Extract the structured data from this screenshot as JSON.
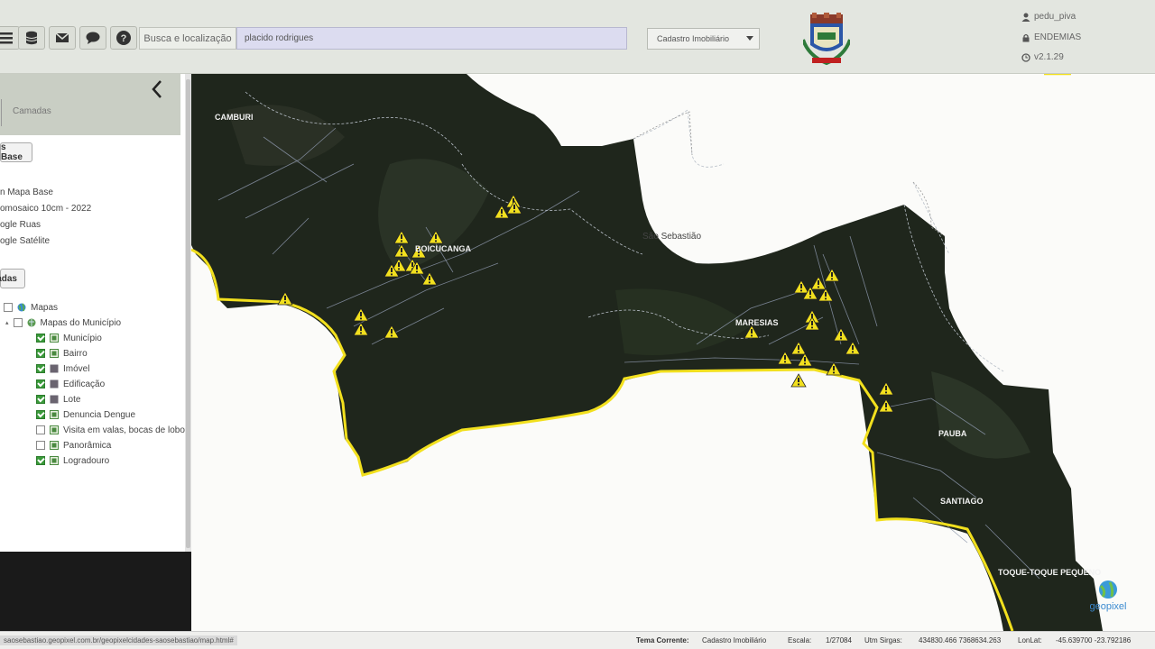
{
  "toolbar": {
    "search_label": "Busca e localização",
    "search_value": "placido rodrigues",
    "tema_selected": "Cadastro Imobiliário",
    "user": "pedu_piva",
    "group": "ENDEMIAS",
    "version": "v2.1.29"
  },
  "sidebar": {
    "title": "Camadas",
    "base_button": "s Base",
    "base_items": [
      "n Mapa Base",
      "omosaico 10cm - 2022",
      "ogle Ruas",
      "ogle Satélite"
    ],
    "layers_button": "adas",
    "layers": [
      {
        "label": "Mapas",
        "checked": false,
        "icon": "globe-icon"
      },
      {
        "label": "Mapas do Município",
        "checked": false,
        "icon": "folder-icon"
      },
      {
        "label": "Município",
        "checked": true,
        "icon": "layer-icon"
      },
      {
        "label": "Bairro",
        "checked": true,
        "icon": "layer-icon"
      },
      {
        "label": "Imóvel",
        "checked": true,
        "icon": "square-icon"
      },
      {
        "label": "Edificação",
        "checked": true,
        "icon": "square-icon"
      },
      {
        "label": "Lote",
        "checked": true,
        "icon": "square-icon"
      },
      {
        "label": "Denuncia Dengue",
        "checked": true,
        "icon": "layer-icon"
      },
      {
        "label": "Visita em valas, bocas de lobo",
        "checked": false,
        "icon": "layer-icon"
      },
      {
        "label": "Panorâmica",
        "checked": false,
        "icon": "layer-icon"
      },
      {
        "label": "Logradouro",
        "checked": true,
        "icon": "layer-icon"
      }
    ]
  },
  "map": {
    "places": {
      "camburi": "CAMBURI",
      "boicucanga": "BOICUCANGA",
      "sao_sebastiao": "São Sebastião",
      "maresias": "MARESIAS",
      "pauba": "PAUBA",
      "santiago": "SANTIAGO",
      "toque": "TOQUE-TOQUE PEQUENO"
    },
    "logo_text": "geopixel"
  },
  "status": {
    "url": "saosebastiao.geopixel.com.br/geopixelcidades-saosebastiao/map.html#",
    "tema_label": "Tema Corrente:",
    "tema_value": "Cadastro Imobiliário",
    "escala_label": "Escala:",
    "escala_value": "1/27084",
    "utm_label": "Utm Sirgas:",
    "utm_value": "434830.466 7368634.263",
    "lonlat_label": "LonLat:",
    "lonlat_value": "-45.639700 -23.792186"
  },
  "colors": {
    "accent_yellow": "#f2e01e",
    "toolbar": "#e3e6e0",
    "map_dark": "#1f261c"
  }
}
